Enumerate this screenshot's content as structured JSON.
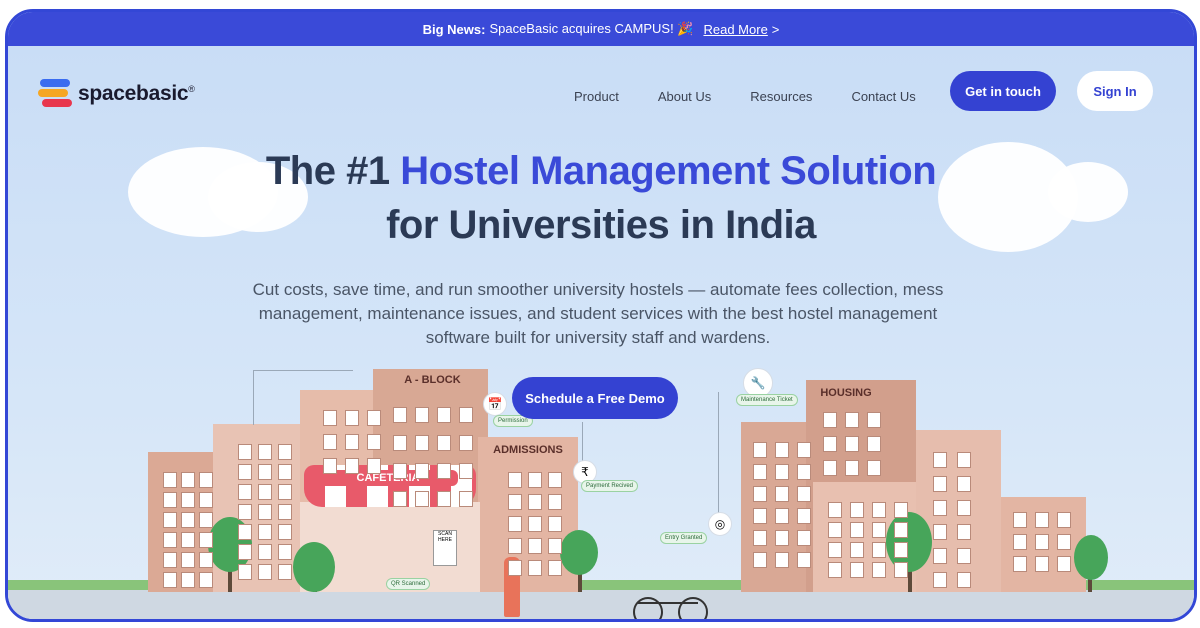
{
  "announcement": {
    "label": "Big News:",
    "text": "SpaceBasic acquires CAMPUS! 🎉",
    "link": "Read More",
    "chevron": ">"
  },
  "nav": {
    "brand": "spacebasic",
    "brand_mark": "®",
    "links": [
      "Product",
      "About Us",
      "Resources",
      "Contact Us"
    ],
    "primary_button": "Get in touch",
    "secondary_button": "Sign In"
  },
  "hero": {
    "title_prefix": "The #1",
    "title_accent": "Hostel Management Solution",
    "title_line2": "for Universities in India",
    "subtext": "Cut costs, save time, and run smoother university hostels — automate fees collection, mess management, maintenance issues, and student services with the best hostel management software built for university staff and wardens.",
    "cta": "Schedule a Free Demo"
  },
  "illustration": {
    "signs": [
      "A - BLOCK",
      "ADMISSIONS",
      "CAFETERIA",
      "HOUSING"
    ],
    "badges": [
      "Permission",
      "Payment Recived",
      "Entry Granted",
      "Maintenance Ticket",
      "QR Scanned"
    ],
    "scan_sign": "SCAN HERE"
  },
  "colors": {
    "accent": "#3a4ad8",
    "headline": "#2b3a55",
    "frame": "#3347d6"
  }
}
